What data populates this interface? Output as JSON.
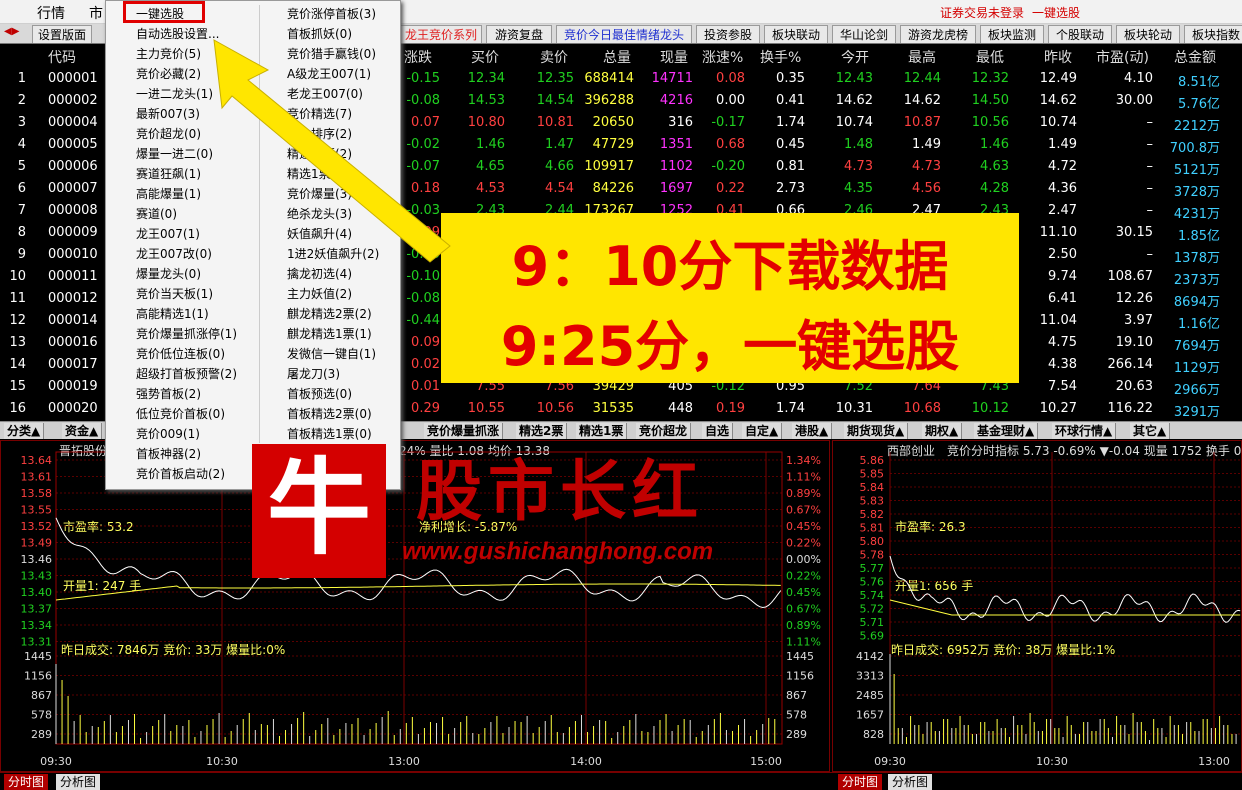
{
  "menubar": {
    "items": [
      "行情",
      "市"
    ],
    "right_status": "证券交易未登录",
    "right_action": "一键选股"
  },
  "tabs": [
    {
      "label": "设置版面",
      "style": "normal"
    },
    {
      "label": "龙王竞价系列",
      "style": "red"
    },
    {
      "label": "游资复盘",
      "style": "normal"
    },
    {
      "label": "竞价今日最佳情绪龙头",
      "style": "blue"
    },
    {
      "label": "投资参股",
      "style": "normal"
    },
    {
      "label": "板块联动",
      "style": "normal"
    },
    {
      "label": "华山论剑",
      "style": "normal"
    },
    {
      "label": "游资龙虎榜",
      "style": "normal"
    },
    {
      "label": "板块监测",
      "style": "normal"
    },
    {
      "label": "个股联动",
      "style": "normal"
    },
    {
      "label": "板块轮动",
      "style": "normal"
    },
    {
      "label": "板块指数",
      "style": "normal"
    }
  ],
  "table": {
    "headers": [
      "代码",
      "涨跌",
      "买价",
      "卖价",
      "总量",
      "现量",
      "涨速%",
      "换手%",
      "今开",
      "最高",
      "最低",
      "昨收",
      "市盈(动)",
      "总金额"
    ],
    "rows": [
      {
        "idx": "1",
        "code": "000001",
        "chg": "-0.15",
        "bid": "12.34",
        "ask": "12.35",
        "vol": "688414",
        "cur": "14711",
        "spd": "0.08",
        "turn": "0.35",
        "open": "12.43",
        "high": "12.44",
        "low": "12.32",
        "prev": "12.49",
        "pe": "4.10",
        "amt": "8.51亿",
        "c": [
          "fall",
          "fall",
          "fall",
          "yel",
          "mag",
          "rise",
          "flat",
          "fall",
          "fall",
          "fall",
          "flat",
          "flat",
          "cyn"
        ]
      },
      {
        "idx": "2",
        "code": "000002",
        "chg": "-0.08",
        "bid": "14.53",
        "ask": "14.54",
        "vol": "396288",
        "cur": "4216",
        "spd": "0.00",
        "turn": "0.41",
        "open": "14.62",
        "high": "14.62",
        "low": "14.50",
        "prev": "14.62",
        "pe": "30.00",
        "amt": "5.76亿",
        "c": [
          "fall",
          "fall",
          "fall",
          "yel",
          "mag",
          "flat",
          "flat",
          "flat",
          "flat",
          "fall",
          "flat",
          "flat",
          "cyn"
        ]
      },
      {
        "idx": "3",
        "code": "000004",
        "chg": "0.07",
        "bid": "10.80",
        "ask": "10.81",
        "vol": "20650",
        "cur": "316",
        "spd": "-0.17",
        "turn": "1.74",
        "open": "10.74",
        "high": "10.87",
        "low": "10.56",
        "prev": "10.74",
        "pe": "–",
        "amt": "2212万",
        "c": [
          "rise",
          "rise",
          "rise",
          "yel",
          "flat",
          "fall",
          "flat",
          "flat",
          "rise",
          "fall",
          "flat",
          "flat",
          "cyn"
        ]
      },
      {
        "idx": "4",
        "code": "000005",
        "chg": "-0.02",
        "bid": "1.46",
        "ask": "1.47",
        "vol": "47729",
        "cur": "1351",
        "spd": "0.68",
        "turn": "0.45",
        "open": "1.48",
        "high": "1.49",
        "low": "1.46",
        "prev": "1.49",
        "pe": "–",
        "amt": "700.8万",
        "c": [
          "fall",
          "fall",
          "fall",
          "yel",
          "mag",
          "rise",
          "flat",
          "fall",
          "flat",
          "fall",
          "flat",
          "flat",
          "cyn"
        ]
      },
      {
        "idx": "5",
        "code": "000006",
        "chg": "-0.07",
        "bid": "4.65",
        "ask": "4.66",
        "vol": "109917",
        "cur": "1102",
        "spd": "-0.20",
        "turn": "0.81",
        "open": "4.73",
        "high": "4.73",
        "low": "4.63",
        "prev": "4.72",
        "pe": "–",
        "amt": "5121万",
        "c": [
          "fall",
          "fall",
          "fall",
          "yel",
          "mag",
          "fall",
          "flat",
          "rise",
          "rise",
          "fall",
          "flat",
          "flat",
          "cyn"
        ]
      },
      {
        "idx": "6",
        "code": "000007",
        "chg": "0.18",
        "bid": "4.53",
        "ask": "4.54",
        "vol": "84226",
        "cur": "1697",
        "spd": "0.22",
        "turn": "2.73",
        "open": "4.35",
        "high": "4.56",
        "low": "4.28",
        "prev": "4.36",
        "pe": "–",
        "amt": "3728万",
        "c": [
          "rise",
          "rise",
          "rise",
          "yel",
          "mag",
          "rise",
          "flat",
          "fall",
          "rise",
          "fall",
          "flat",
          "flat",
          "cyn"
        ]
      },
      {
        "idx": "7",
        "code": "000008",
        "chg": "-0.03",
        "bid": "2.43",
        "ask": "2.44",
        "vol": "173267",
        "cur": "1252",
        "spd": "0.41",
        "turn": "0.66",
        "open": "2.46",
        "high": "2.47",
        "low": "2.43",
        "prev": "2.47",
        "pe": "–",
        "amt": "4231万",
        "c": [
          "fall",
          "fall",
          "fall",
          "yel",
          "mag",
          "rise",
          "flat",
          "fall",
          "flat",
          "fall",
          "flat",
          "flat",
          "cyn"
        ]
      },
      {
        "idx": "8",
        "code": "000009",
        "chg": "0.09",
        "bid": "",
        "ask": "",
        "vol": "",
        "cur": "",
        "spd": "",
        "turn": "",
        "open": "",
        "high": "",
        "low": "",
        "prev": "11.10",
        "pe": "30.15",
        "amt": "1.85亿",
        "c": [
          "rise",
          "flat",
          "flat",
          "flat",
          "flat",
          "flat",
          "flat",
          "flat",
          "flat",
          "flat",
          "flat",
          "flat",
          "cyn"
        ]
      },
      {
        "idx": "9",
        "code": "000010",
        "chg": "-0.05",
        "bid": "",
        "ask": "",
        "vol": "",
        "cur": "",
        "spd": "",
        "turn": "",
        "open": "",
        "high": "",
        "low": "",
        "prev": "2.50",
        "pe": "–",
        "amt": "1378万",
        "c": [
          "fall",
          "flat",
          "flat",
          "flat",
          "flat",
          "flat",
          "flat",
          "flat",
          "flat",
          "flat",
          "flat",
          "flat",
          "cyn"
        ]
      },
      {
        "idx": "10",
        "code": "000011",
        "chg": "-0.10",
        "bid": "",
        "ask": "",
        "vol": "",
        "cur": "",
        "spd": "",
        "turn": "",
        "open": "",
        "high": "",
        "low": "",
        "prev": "9.74",
        "pe": "108.67",
        "amt": "2373万",
        "c": [
          "fall",
          "flat",
          "flat",
          "flat",
          "flat",
          "flat",
          "flat",
          "flat",
          "flat",
          "flat",
          "flat",
          "flat",
          "cyn"
        ]
      },
      {
        "idx": "11",
        "code": "000012",
        "chg": "-0.08",
        "bid": "",
        "ask": "",
        "vol": "",
        "cur": "",
        "spd": "",
        "turn": "",
        "open": "",
        "high": "",
        "low": "",
        "prev": "6.41",
        "pe": "12.26",
        "amt": "8694万",
        "c": [
          "fall",
          "flat",
          "flat",
          "flat",
          "flat",
          "flat",
          "flat",
          "flat",
          "flat",
          "flat",
          "flat",
          "flat",
          "cyn"
        ]
      },
      {
        "idx": "12",
        "code": "000014",
        "chg": "-0.44",
        "bid": "",
        "ask": "",
        "vol": "",
        "cur": "",
        "spd": "",
        "turn": "",
        "open": "",
        "high": "",
        "low": "",
        "prev": "11.04",
        "pe": "3.97",
        "amt": "1.16亿",
        "c": [
          "fall",
          "flat",
          "flat",
          "flat",
          "flat",
          "flat",
          "flat",
          "flat",
          "flat",
          "flat",
          "flat",
          "flat",
          "cyn"
        ]
      },
      {
        "idx": "13",
        "code": "000016",
        "chg": "0.09",
        "bid": "",
        "ask": "",
        "vol": "",
        "cur": "",
        "spd": "",
        "turn": "",
        "open": "",
        "high": "",
        "low": "",
        "prev": "4.75",
        "pe": "19.10",
        "amt": "7694万",
        "c": [
          "rise",
          "flat",
          "flat",
          "flat",
          "flat",
          "flat",
          "flat",
          "flat",
          "flat",
          "flat",
          "flat",
          "flat",
          "cyn"
        ]
      },
      {
        "idx": "14",
        "code": "000017",
        "chg": "0.02",
        "bid": "",
        "ask": "",
        "vol": "",
        "cur": "",
        "spd": "",
        "turn": "",
        "open": "",
        "high": "",
        "low": "",
        "prev": "4.38",
        "pe": "266.14",
        "amt": "1129万",
        "c": [
          "rise",
          "flat",
          "flat",
          "flat",
          "flat",
          "flat",
          "flat",
          "flat",
          "flat",
          "flat",
          "flat",
          "flat",
          "cyn"
        ]
      },
      {
        "idx": "15",
        "code": "000019",
        "chg": "0.01",
        "bid": "7.55",
        "ask": "7.56",
        "vol": "39429",
        "cur": "405",
        "spd": "-0.12",
        "turn": "0.95",
        "open": "7.52",
        "high": "7.64",
        "low": "7.43",
        "prev": "7.54",
        "pe": "20.63",
        "amt": "2966万",
        "c": [
          "rise",
          "rise",
          "rise",
          "yel",
          "flat",
          "fall",
          "flat",
          "fall",
          "rise",
          "fall",
          "flat",
          "flat",
          "cyn"
        ]
      },
      {
        "idx": "16",
        "code": "000020",
        "chg": "0.29",
        "bid": "10.55",
        "ask": "10.56",
        "vol": "31535",
        "cur": "448",
        "spd": "0.19",
        "turn": "1.74",
        "open": "10.31",
        "high": "10.68",
        "low": "10.12",
        "prev": "10.27",
        "pe": "116.22",
        "amt": "3291万",
        "c": [
          "rise",
          "rise",
          "rise",
          "yel",
          "flat",
          "rise",
          "flat",
          "flat",
          "rise",
          "fall",
          "flat",
          "flat",
          "cyn"
        ]
      }
    ]
  },
  "sector_tabs": [
    "分类▲",
    "资金▲",
    "竞价爆量抓涨",
    "精选2票",
    "精选1票",
    "竞价超龙",
    "自选",
    "自定▲",
    "港股▲",
    "期货现货▲",
    "期权▲",
    "基金理财▲",
    "环球行情▲",
    "其它▲"
  ],
  "dropdown": {
    "left": [
      "一键选股",
      "自动选股设置...",
      "主力竞价(5)",
      "竞价必藏(2)",
      "一进二龙头(1)",
      "最新007(3)",
      "竞价超龙(0)",
      "爆量一进二(0)",
      "赛道狂飙(1)",
      "高能爆量(1)",
      "赛道(0)",
      "龙王007(1)",
      "龙王007改(0)",
      "爆量龙头(0)",
      "竞价当天板(1)",
      "高能精选1(1)",
      "竞价爆量抓涨停(1)",
      "竞价低位连板(0)",
      "超级打首板预警(2)",
      "强势首板(2)",
      "低位竞价首板(0)",
      "竞价009(1)",
      "首板神器(2)",
      "竞价首板启动(2)"
    ],
    "right": [
      "竞价涨停首板(3)",
      "首板抓妖(0)",
      "竞价猎手赢钱(0)",
      "A级龙王007(1)",
      "老龙王007(0)",
      "竞价精选(7)",
      "竞价排序(2)",
      "精选二票(2)",
      "精选1票(1)",
      "竞价爆量(3)",
      "绝杀龙头(3)",
      "妖值飙升(4)",
      "1进2妖值飙升(2)",
      "擒龙初选(4)",
      "主力妖值(2)",
      "麒龙精选2票(2)",
      "麒龙精选1票(1)",
      "发微信一键自(1)",
      "屠龙刀(3)",
      "首板预选(0)",
      "首板精选2票(0)",
      "首板精选1票(0)"
    ]
  },
  "banner": {
    "line1": "9：10分下载数据",
    "line2": "9:25分，一键选股"
  },
  "watermark": {
    "char": "牛",
    "text": "股市长红",
    "url": "www.gushichanghong.com"
  },
  "left_panel": {
    "stock": "晋拓股份",
    "header_right": "24% 量比 1.08 均价 13.38",
    "pe": "市盈率: 53.2",
    "profit": "净利增长: -5.87%",
    "open_vol": "开量1: 247 手",
    "prev_info": "昨日成交: 7846万 竞价: 33万 爆量比:0%",
    "price_ticks": [
      "13.64",
      "13.61",
      "13.58",
      "13.55",
      "13.52",
      "13.49",
      "13.46",
      "13.43",
      "13.40",
      "13.37",
      "13.34",
      "13.31"
    ],
    "pct_ticks": [
      "1.34%",
      "1.11%",
      "0.89%",
      "0.67%",
      "0.45%",
      "0.22%",
      "0.00%",
      "0.22%",
      "0.45%",
      "0.67%",
      "0.89%",
      "1.11%"
    ],
    "vol_ticks": [
      "1445",
      "1156",
      "867",
      "578",
      "289"
    ],
    "time_ticks": [
      "09:30",
      "10:30",
      "13:00",
      "14:00",
      "15:00"
    ]
  },
  "right_panel": {
    "stock": "西部创业",
    "header": "竞价分时指标 5.73 -0.69% ▼-0.04 现量 1752 换手 0.73",
    "pe": "市盈率: 26.3",
    "open_vol": "开量1: 656 手",
    "prev_info": "昨日成交: 6952万 竞价: 38万 爆量比:1%",
    "price_ticks": [
      "5.86",
      "5.85",
      "5.84",
      "5.83",
      "5.82",
      "5.81",
      "5.80",
      "5.78",
      "5.77",
      "5.76",
      "5.74",
      "5.72",
      "5.71",
      "5.69"
    ],
    "vol_ticks": [
      "4142",
      "3313",
      "2485",
      "1657",
      "828"
    ],
    "time_ticks": [
      "09:30",
      "10:30",
      "13:00"
    ]
  },
  "bottom_tabs": {
    "active": "分时图",
    "inactive": "分析图"
  },
  "colors": {
    "rise": "#ff4040",
    "fall": "#20d020",
    "banner_bg": "#ffe600",
    "banner_text": "#e30000",
    "arrow": "#ffe600"
  }
}
